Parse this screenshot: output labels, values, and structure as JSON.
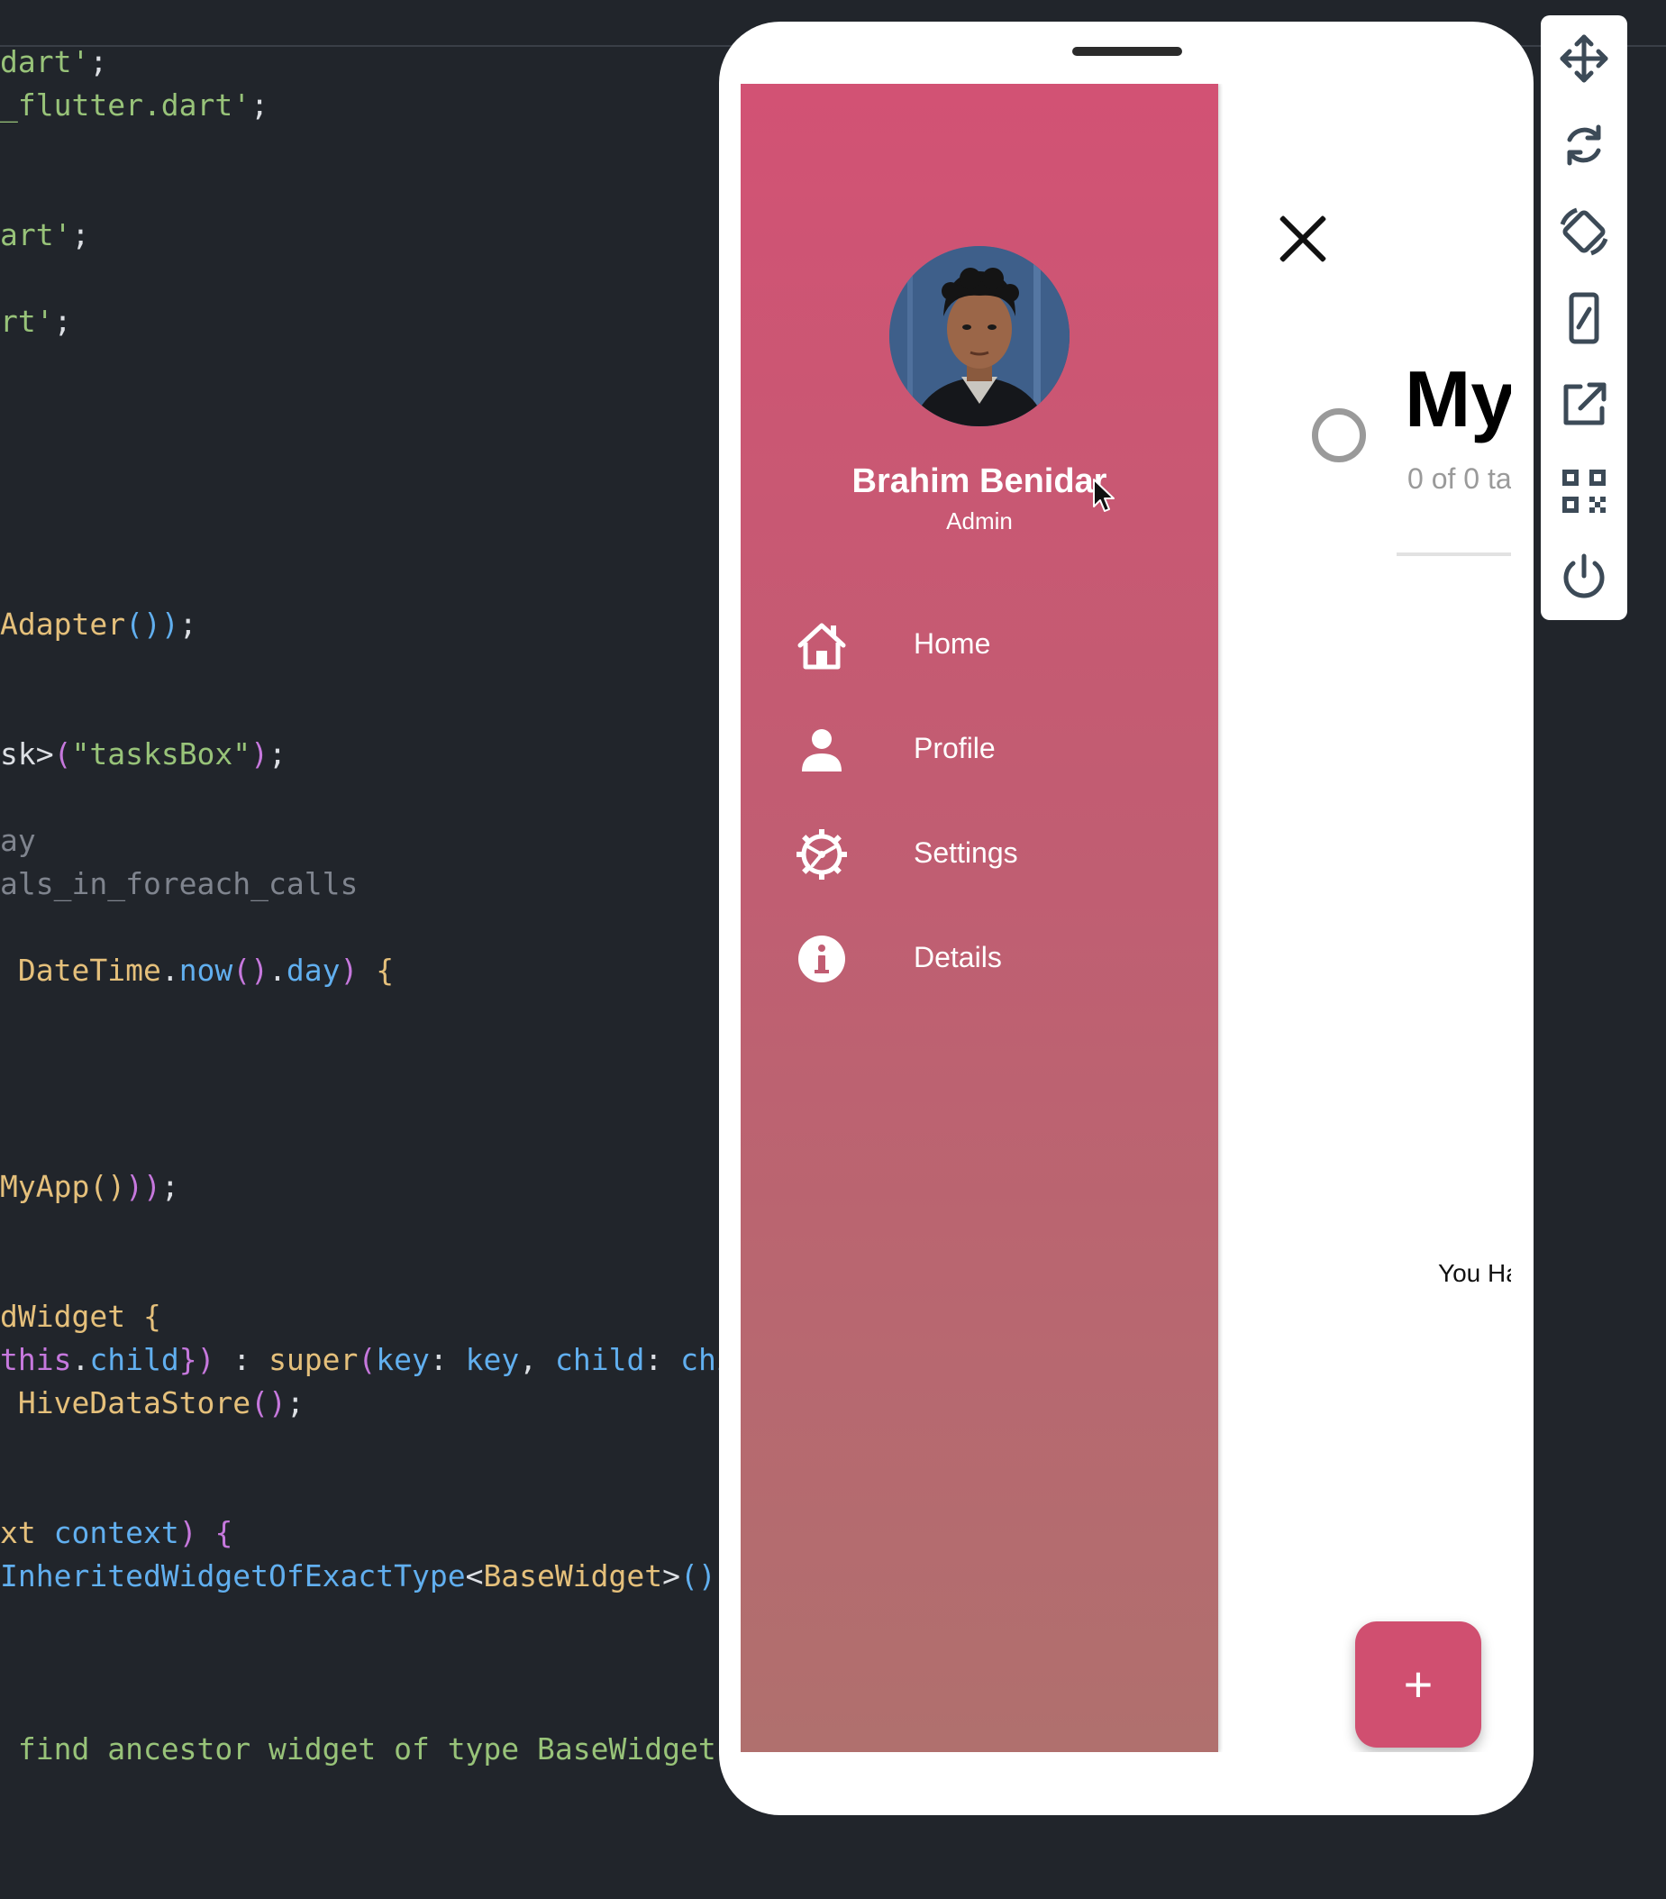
{
  "editor": {
    "lines": [
      {
        "parts": [
          {
            "t": "dart'",
            "c": "t-str"
          },
          {
            "t": ";",
            "c": "t-def"
          }
        ]
      },
      {
        "parts": [
          {
            "t": "_flutter.dart'",
            "c": "t-str"
          },
          {
            "t": ";",
            "c": "t-def"
          }
        ]
      },
      {
        "parts": [
          {
            "t": "art'",
            "c": "t-str"
          },
          {
            "t": ";",
            "c": "t-def"
          }
        ]
      },
      {
        "parts": [
          {
            "t": "rt'",
            "c": "t-str"
          },
          {
            "t": ";",
            "c": "t-def"
          }
        ]
      },
      {
        "parts": [
          {
            "t": "Adapter",
            "c": "t-type"
          },
          {
            "t": "()",
            "c": "t-paren1"
          },
          {
            "t": ")",
            "c": "t-paren1"
          },
          {
            "t": ";",
            "c": "t-def"
          }
        ]
      },
      {
        "parts": [
          {
            "t": "sk>",
            "c": "t-def"
          },
          {
            "t": "(",
            "c": "t-paren2"
          },
          {
            "t": "\"tasksBox\"",
            "c": "t-str"
          },
          {
            "t": ")",
            "c": "t-paren2"
          },
          {
            "t": ";",
            "c": "t-def"
          }
        ]
      },
      {
        "parts": [
          {
            "t": "ay",
            "c": "t-cm"
          }
        ]
      },
      {
        "parts": [
          {
            "t": "als_in_foreach_calls",
            "c": "t-cm"
          }
        ]
      },
      {
        "parts": [
          {
            "t": " DateTime",
            "c": "t-type"
          },
          {
            "t": ".",
            "c": "t-def"
          },
          {
            "t": "now",
            "c": "t-fn"
          },
          {
            "t": "()",
            "c": "t-paren2"
          },
          {
            "t": ".",
            "c": "t-def"
          },
          {
            "t": "day",
            "c": "t-fn"
          },
          {
            "t": ") ",
            "c": "t-paren2"
          },
          {
            "t": "{",
            "c": "t-paren3"
          }
        ]
      },
      {
        "parts": [
          {
            "t": "MyApp",
            "c": "t-type"
          },
          {
            "t": "()",
            "c": "t-paren3"
          },
          {
            "t": "))",
            "c": "t-paren2"
          },
          {
            "t": ";",
            "c": "t-def"
          }
        ]
      },
      {
        "parts": [
          {
            "t": "dWidget ",
            "c": "t-type"
          },
          {
            "t": "{",
            "c": "t-paren3"
          }
        ]
      },
      {
        "parts": [
          {
            "t": "this",
            "c": "t-kw"
          },
          {
            "t": ".",
            "c": "t-def"
          },
          {
            "t": "child",
            "c": "t-fn"
          },
          {
            "t": "})",
            "c": "t-paren2"
          },
          {
            "t": " : ",
            "c": "t-def"
          },
          {
            "t": "super",
            "c": "t-type"
          },
          {
            "t": "(",
            "c": "t-paren2"
          },
          {
            "t": "key",
            "c": "t-fn"
          },
          {
            "t": ": ",
            "c": "t-def"
          },
          {
            "t": "key",
            "c": "t-fn"
          },
          {
            "t": ", ",
            "c": "t-def"
          },
          {
            "t": "child",
            "c": "t-fn"
          },
          {
            "t": ": ",
            "c": "t-def"
          },
          {
            "t": "chi",
            "c": "t-fn"
          }
        ]
      },
      {
        "parts": [
          {
            "t": " HiveDataStore",
            "c": "t-type"
          },
          {
            "t": "()",
            "c": "t-paren2"
          },
          {
            "t": ";",
            "c": "t-def"
          }
        ]
      },
      {
        "parts": [
          {
            "t": "xt ",
            "c": "t-type"
          },
          {
            "t": "context",
            "c": "t-fn"
          },
          {
            "t": ") ",
            "c": "t-paren2"
          },
          {
            "t": "{",
            "c": "t-paren2"
          }
        ]
      },
      {
        "parts": [
          {
            "t": "InheritedWidgetOfExactType",
            "c": "t-fn"
          },
          {
            "t": "<",
            "c": "t-def"
          },
          {
            "t": "BaseWidget",
            "c": "t-type"
          },
          {
            "t": ">",
            "c": "t-def"
          },
          {
            "t": "()",
            "c": "t-paren1"
          },
          {
            "t": ";",
            "c": "t-def"
          }
        ]
      },
      {
        "parts": [
          {
            "t": " find ancestor widget of type BaseWidget'",
            "c": "t-str"
          },
          {
            "t": ")",
            "c": "t-paren3"
          }
        ]
      }
    ]
  },
  "drawer": {
    "user_name": "Brahim Benidar",
    "user_role": "Admin",
    "menu": [
      {
        "label": "Home",
        "icon": "home-icon"
      },
      {
        "label": "Profile",
        "icon": "person-icon"
      },
      {
        "label": "Settings",
        "icon": "gear-icon"
      },
      {
        "label": "Details",
        "icon": "info-icon"
      }
    ]
  },
  "app": {
    "title": "My",
    "subtitle": "0 of 0 ta",
    "empty_text": "You Ha",
    "fab_label": "+",
    "accent": "#d04f70"
  },
  "toolbar": {
    "buttons": [
      "move-icon",
      "rotate-icon",
      "screen-rotate-icon",
      "device-resize-icon",
      "open-external-icon",
      "qr-code-icon",
      "power-icon"
    ]
  }
}
